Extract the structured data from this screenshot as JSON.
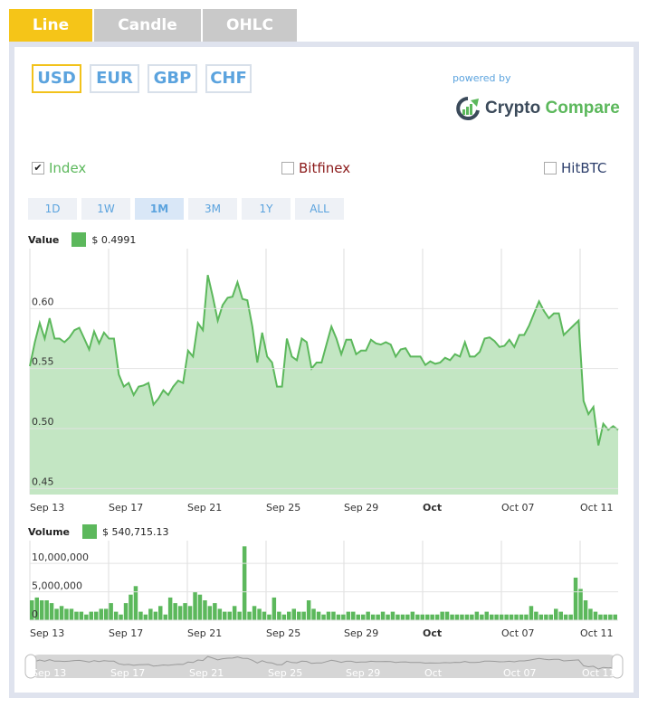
{
  "tabs": [
    {
      "label": "Line",
      "active": true
    },
    {
      "label": "Candle",
      "active": false
    },
    {
      "label": "OHLC",
      "active": false
    }
  ],
  "currencies": [
    {
      "label": "USD",
      "active": true
    },
    {
      "label": "EUR",
      "active": false
    },
    {
      "label": "GBP",
      "active": false
    },
    {
      "label": "CHF",
      "active": false
    }
  ],
  "branding": {
    "powered_by": "powered by",
    "logo_part1": "Crypto",
    "logo_part2": "Compare"
  },
  "exchanges": [
    {
      "label": "Index",
      "checked": true,
      "color": "#5cb85c"
    },
    {
      "label": "Bitfinex",
      "checked": false,
      "color": "#8b1a1a"
    },
    {
      "label": "HitBTC",
      "checked": false,
      "color": "#2c3e6b"
    }
  ],
  "ranges": [
    {
      "label": "1D",
      "active": false
    },
    {
      "label": "1W",
      "active": false
    },
    {
      "label": "1M",
      "active": true
    },
    {
      "label": "3M",
      "active": false
    },
    {
      "label": "1Y",
      "active": false
    },
    {
      "label": "ALL",
      "active": false
    }
  ],
  "value_legend": {
    "label": "Value",
    "value": "$ 0.4991"
  },
  "volume_legend": {
    "label": "Volume",
    "value": "$ 540,715.13"
  },
  "colors": {
    "accent": "#f5c518",
    "series": "#5cb85c",
    "area": "#c3e6c3",
    "link": "#5ba3de"
  },
  "chart_data": [
    {
      "type": "area",
      "series": [
        {
          "name": "Index",
          "values": [
            0.552,
            0.572,
            0.588,
            0.575,
            0.592,
            0.575,
            0.575,
            0.572,
            0.576,
            0.582,
            0.584,
            0.575,
            0.566,
            0.581,
            0.571,
            0.58,
            0.575,
            0.575,
            0.545,
            0.535,
            0.538,
            0.528,
            0.535,
            0.536,
            0.538,
            0.52,
            0.525,
            0.532,
            0.528,
            0.535,
            0.54,
            0.538,
            0.565,
            0.56,
            0.588,
            0.582,
            0.628,
            0.61,
            0.59,
            0.603,
            0.609,
            0.61,
            0.622,
            0.608,
            0.607,
            0.585,
            0.555,
            0.58,
            0.56,
            0.555,
            0.535,
            0.535,
            0.575,
            0.56,
            0.557,
            0.575,
            0.572,
            0.55,
            0.555,
            0.555,
            0.57,
            0.585,
            0.575,
            0.562,
            0.574,
            0.574,
            0.562,
            0.565,
            0.565,
            0.574,
            0.571,
            0.57,
            0.572,
            0.57,
            0.56,
            0.566,
            0.567,
            0.56,
            0.56,
            0.56,
            0.553,
            0.556,
            0.554,
            0.555,
            0.559,
            0.557,
            0.562,
            0.56,
            0.572,
            0.56,
            0.56,
            0.564,
            0.575,
            0.576,
            0.573,
            0.568,
            0.569,
            0.574,
            0.568,
            0.578,
            0.578,
            0.586,
            0.596,
            0.606,
            0.598,
            0.592,
            0.596,
            0.596,
            0.578,
            0.582,
            0.586,
            0.59,
            0.523,
            0.512,
            0.518,
            0.486,
            0.504,
            0.499,
            0.502,
            0.499
          ]
        }
      ],
      "x_tick_labels": [
        "Sep 13",
        "Sep 17",
        "Sep 21",
        "Sep 25",
        "Sep 29",
        "Oct",
        "Oct 07",
        "Oct 11"
      ],
      "y_tick_labels": [
        "0.45",
        "0.50",
        "0.55",
        "0.60"
      ],
      "ylim": [
        0.445,
        0.65
      ]
    },
    {
      "type": "bar",
      "series": [
        {
          "name": "Volume",
          "values": [
            3500000,
            4000000,
            3500000,
            3500000,
            3000000,
            2000000,
            2500000,
            2000000,
            2000000,
            1500000,
            1500000,
            1000000,
            1500000,
            1500000,
            2000000,
            2000000,
            3000000,
            1500000,
            1000000,
            3000000,
            4500000,
            6000000,
            1500000,
            1000000,
            2000000,
            1500000,
            2500000,
            1000000,
            4000000,
            3000000,
            2500000,
            3000000,
            2500000,
            5000000,
            4500000,
            3500000,
            2500000,
            3000000,
            2000000,
            1500000,
            1500000,
            2500000,
            1500000,
            13000000,
            1500000,
            2500000,
            2000000,
            1500000,
            1000000,
            4000000,
            1500000,
            1000000,
            1500000,
            2000000,
            1500000,
            1500000,
            3500000,
            2000000,
            1500000,
            1000000,
            1500000,
            1500000,
            1000000,
            1000000,
            1500000,
            1500000,
            1000000,
            1000000,
            1500000,
            1000000,
            1000000,
            1500000,
            1000000,
            1500000,
            1000000,
            1000000,
            1000000,
            1500000,
            1000000,
            1000000,
            1000000,
            1000000,
            1000000,
            1500000,
            1500000,
            1000000,
            1000000,
            1000000,
            1000000,
            1000000,
            1500000,
            1000000,
            1500000,
            1000000,
            1000000,
            1000000,
            1000000,
            1000000,
            1000000,
            1000000,
            1000000,
            2500000,
            1500000,
            1000000,
            1000000,
            1000000,
            2000000,
            1500000,
            1000000,
            1000000,
            7500000,
            5500000,
            3500000,
            2000000,
            1500000,
            1000000,
            1000000,
            1000000,
            1000000
          ]
        }
      ],
      "x_tick_labels": [
        "Sep 13",
        "Sep 17",
        "Sep 21",
        "Sep 25",
        "Sep 29",
        "Oct",
        "Oct 07",
        "Oct 11"
      ],
      "y_tick_labels": [
        "0",
        "5,000,000",
        "10,000,000"
      ],
      "ylim": [
        0,
        14000000
      ]
    }
  ],
  "navigator": {
    "tick_labels": [
      "Sep 13",
      "Sep 17",
      "Sep 21",
      "Sep 25",
      "Sep 29",
      "Oct",
      "Oct 07",
      "Oct 11"
    ]
  }
}
